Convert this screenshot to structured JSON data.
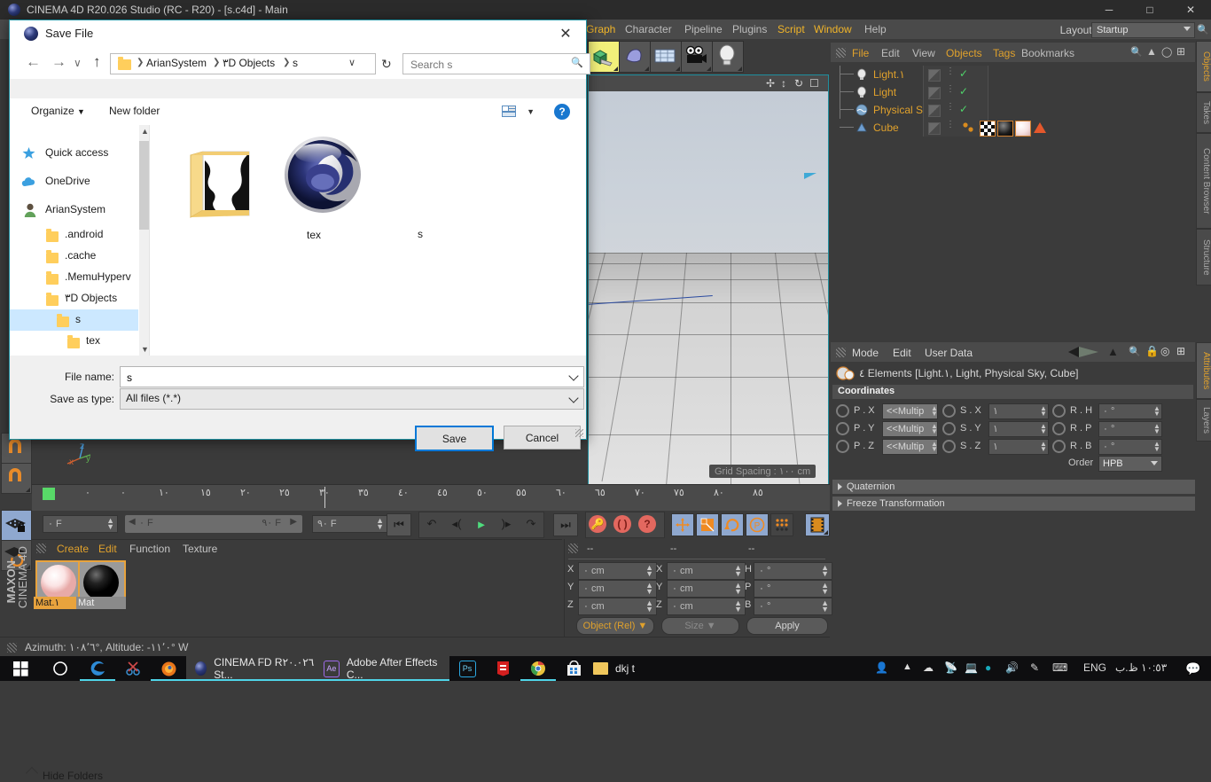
{
  "app": {
    "title": "CINEMA 4D R20.026 Studio (RC - R20) - [s.c4d] - Main",
    "window_buttons": {
      "minimize": "─",
      "maximize": "□",
      "close": "✕"
    },
    "menus": [
      {
        "label": "Graph",
        "accent": true
      },
      {
        "label": "Character",
        "accent": false
      },
      {
        "label": "Pipeline",
        "accent": false
      },
      {
        "label": "Plugins",
        "accent": false
      },
      {
        "label": "Script",
        "accent": true
      },
      {
        "label": "Window",
        "accent": true
      },
      {
        "label": "Help",
        "accent": false
      }
    ],
    "layout_label": "Layout:",
    "layout_value": "Startup",
    "search_icon": "🔍"
  },
  "viewport": {
    "grid_spacing": "Grid Spacing : ١٠٠ cm",
    "icons": [
      "move-axis-icon",
      "updown-axis-icon",
      "rotate-axis-icon",
      "frame-icon"
    ],
    "axis_labels": [
      "z",
      "x",
      "y"
    ]
  },
  "objects_panel": {
    "menus": [
      "File",
      "Edit",
      "View",
      "Objects",
      "Tags",
      "Bookmarks"
    ],
    "menu_accent": [
      true,
      false,
      false,
      true,
      true,
      false
    ],
    "header_icons": [
      "search-icon",
      "up-arrow-icon",
      "ellipse-icon",
      "grid-icon"
    ],
    "rows": [
      {
        "name": "Light.١",
        "icon": "light-icon",
        "tick": true
      },
      {
        "name": "Light",
        "icon": "light-icon",
        "tick": true
      },
      {
        "name": "Physical Sky",
        "icon": "sky-icon",
        "tick": true
      },
      {
        "name": "Cube",
        "icon": "cube-icon",
        "tick": false
      }
    ],
    "cube_tags": [
      "dots-tag",
      "checker-tag",
      "dark-sphere-tag",
      "light-sphere-tag",
      "triangle-tag"
    ]
  },
  "attributes_panel": {
    "menus": [
      "Mode",
      "Edit",
      "User Data"
    ],
    "header_icons": [
      "back-arrow-icon",
      "up-arrow-icon",
      "search-icon",
      "lock-icon",
      "target-icon",
      "plus-icon"
    ],
    "element_label": "٤ Elements [Light.١, Light, Physical Sky, Cube]",
    "section_title": "Coordinates",
    "rows": [
      {
        "p_label": "P . X",
        "p_value": "<<Multip",
        "s_label": "S . X",
        "s_value": "١",
        "r_label": "R . H",
        "r_value": "٠ °"
      },
      {
        "p_label": "P . Y",
        "p_value": "<<Multip",
        "s_label": "S . Y",
        "s_value": "١",
        "r_label": "R . P",
        "r_value": "٠ °"
      },
      {
        "p_label": "P . Z",
        "p_value": "<<Multip",
        "s_label": "S . Z",
        "s_value": "١",
        "r_label": "R . B",
        "r_value": "٠ °"
      }
    ],
    "order_label": "Order",
    "order_value": "HPB",
    "accordions": [
      "Quaternion",
      "Freeze Transformation"
    ]
  },
  "vertical_tabs": [
    {
      "label": "Objects",
      "active": true
    },
    {
      "label": "Takes",
      "active": false
    },
    {
      "label": "Content Browser",
      "active": false
    },
    {
      "label": "Structure",
      "active": false
    },
    {
      "label": "Attributes",
      "active": true
    },
    {
      "label": "Layers",
      "active": false
    }
  ],
  "timeline": {
    "ruler_numbers": [
      "٠",
      "١٠",
      "٢٠",
      "٢٥",
      "٣٠",
      "٣٥",
      "٤٠",
      "٤٥"
    ],
    "ruler_numbers_display": [
      "٠",
      "١٠",
      "١٥",
      "٢٠",
      "٢٥",
      "٣٠",
      "٣٥",
      "٤٥"
    ],
    "current_frame": "٠ F",
    "range_start": "٠ F",
    "range_end": "٩٠ F",
    "end_frame": "٩٠ F"
  },
  "transport": {
    "buttons": [
      "go-to-start-icon",
      "loop-icon",
      "step-back-icon",
      "play-icon",
      "step-forward-icon",
      "loop-end-icon",
      "go-to-end-icon"
    ],
    "record_buttons": [
      "record-key-icon",
      "autokey-icon",
      "key-help-icon"
    ],
    "tool_buttons": [
      "move-tool-icon",
      "scale-tool-icon",
      "rotate-tool-icon",
      "parametric-icon",
      "dots-icon"
    ],
    "render_button": "render-view-icon"
  },
  "material_manager": {
    "menus": [
      "Create",
      "Edit",
      "Function",
      "Texture"
    ],
    "materials": [
      {
        "name": "Mat.١",
        "selected": true
      },
      {
        "name": "Mat",
        "selected": false
      }
    ]
  },
  "coordinate_manager": {
    "headers": [
      "--",
      "--",
      "--"
    ],
    "rows": [
      {
        "pos_label": "X",
        "pos_value": "٠ cm",
        "size_label": "X",
        "size_value": "٠ cm",
        "rot_label": "H",
        "rot_value": "٠ °"
      },
      {
        "pos_label": "Y",
        "pos_value": "٠ cm",
        "size_label": "Y",
        "size_value": "٠ cm",
        "rot_label": "P",
        "rot_value": "٠ °"
      },
      {
        "pos_label": "Z",
        "pos_value": "٠ cm",
        "size_label": "Z",
        "size_value": "٠ cm",
        "rot_label": "B",
        "rot_value": "٠ °"
      }
    ],
    "mode_button": "Object (Rel)",
    "size_button": "Size",
    "apply_button": "Apply"
  },
  "status_bar": {
    "text": "Azimuth: ١٠٨٬٦°, Altitude: -١١٬٠°  W"
  },
  "maxon_logo": {
    "line1": "MAXON",
    "line2": "CINEMA 4D"
  },
  "dialog": {
    "title": "Save File",
    "close_icon": "✕",
    "nav": {
      "back": "←",
      "forward": "→",
      "recent": "∨",
      "up": "↑",
      "refresh": "↻"
    },
    "breadcrumbs": [
      "ArianSystem",
      "٣D Objects",
      "s"
    ],
    "breadcrumb_caret": "∨",
    "search_placeholder": "Search s",
    "search_icon": "🔍",
    "toolbar": {
      "organize": "Organize",
      "new_folder": "New folder",
      "view_icon": "view-layout-icon",
      "help_icon": "?"
    },
    "sidebar": [
      {
        "label": "Quick access",
        "icon": "pin-star-icon",
        "indent": 0,
        "selected": false
      },
      {
        "label": "OneDrive",
        "icon": "cloud-icon",
        "indent": 0,
        "selected": false
      },
      {
        "label": "ArianSystem",
        "icon": "user-icon",
        "indent": 0,
        "selected": false
      },
      {
        "label": ".android",
        "icon": "folder-icon",
        "indent": 1,
        "selected": false
      },
      {
        "label": ".cache",
        "icon": "folder-icon",
        "indent": 1,
        "selected": false
      },
      {
        "label": ".MemuHyperv",
        "icon": "folder-icon",
        "indent": 1,
        "selected": false
      },
      {
        "label": "٣D Objects",
        "icon": "folder-icon",
        "indent": 1,
        "selected": false
      },
      {
        "label": "s",
        "icon": "folder-icon",
        "indent": 2,
        "selected": true
      },
      {
        "label": "tex",
        "icon": "folder-icon",
        "indent": 3,
        "selected": false
      }
    ],
    "files": [
      {
        "label": "tex",
        "type": "folder-with-image"
      },
      {
        "label": "s",
        "type": "c4d-file"
      }
    ],
    "file_name_label": "File name:",
    "file_name_value": "s",
    "save_type_label": "Save as type:",
    "save_type_value": "All files (*.*)",
    "hide_folders": "Hide Folders",
    "save_button": "Save",
    "cancel_button": "Cancel"
  },
  "taskbar": {
    "start_icon": "windows-icon",
    "items": [
      {
        "label": "",
        "icon": "cortana-circle-icon",
        "active": false
      },
      {
        "label": "",
        "icon": "edge-icon",
        "active": false
      },
      {
        "label": "",
        "icon": "snip-icon",
        "active": false
      },
      {
        "label": "",
        "icon": "firefox-icon",
        "active": false
      },
      {
        "label": "CINEMA FD R٢٠.٠٢٦ St...",
        "icon": "c4d-icon",
        "active": true
      },
      {
        "label": "Adobe After Effects C...",
        "icon": "ae-icon",
        "active": true
      },
      {
        "label": "",
        "icon": "ps-icon",
        "active": false
      },
      {
        "label": "",
        "icon": "idm-icon",
        "active": false
      },
      {
        "label": "",
        "icon": "chrome-icon",
        "active": false
      },
      {
        "label": "",
        "icon": "store-icon",
        "active": false
      },
      {
        "label": "dkj t",
        "icon": "folder-icon",
        "active": false
      }
    ],
    "tray": [
      "people-icon",
      "chevron-up-icon",
      "onedrive-icon",
      "network-off-icon",
      "pc-error-icon",
      "edge-icon",
      "volume-icon",
      "pen-icon",
      "keyboard-icon"
    ],
    "language": "ENG",
    "clock": "١٠:٥٣ ظ.ب",
    "action_center": "notification-icon"
  },
  "colors": {
    "accent": "#e0a12c",
    "c4d_bg": "#3b3b3b",
    "panel": "#4a4a4a",
    "primary_blue": "#0078d7",
    "cyan": "#1f8f9f"
  }
}
